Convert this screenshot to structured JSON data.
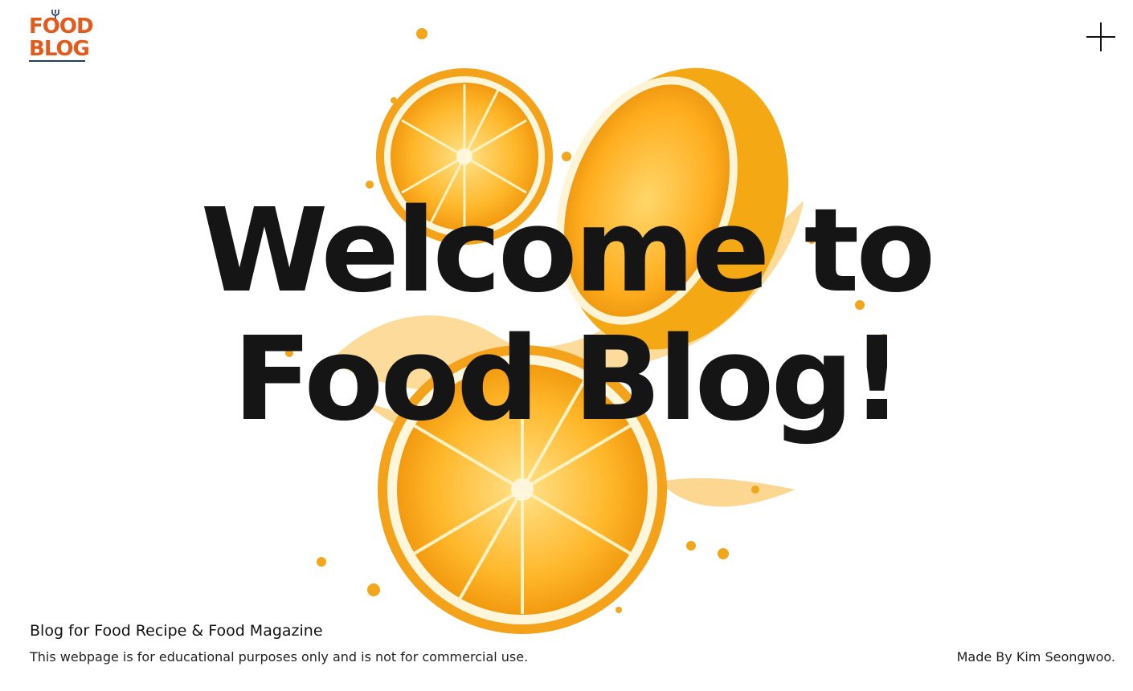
{
  "header": {
    "logo_line1": "FOOD",
    "logo_line2": "BLOG",
    "menu_icon": "plus-icon"
  },
  "hero": {
    "title_line1": "Welcome to",
    "title_line2": "Food Blog!",
    "image_subject": "orange-splash"
  },
  "footer": {
    "tagline": "Blog for Food Recipe & Food Magazine",
    "disclaimer": "This webpage is for educational purposes only and is not for commercial use.",
    "credit": "Made By Kim Seongwoo."
  },
  "colors": {
    "brand_orange": "#e35a1c",
    "brand_navy": "#1f3e64",
    "title": "#151515",
    "orange_fruit": "#f7a51c",
    "orange_light": "#ffcf4a"
  }
}
